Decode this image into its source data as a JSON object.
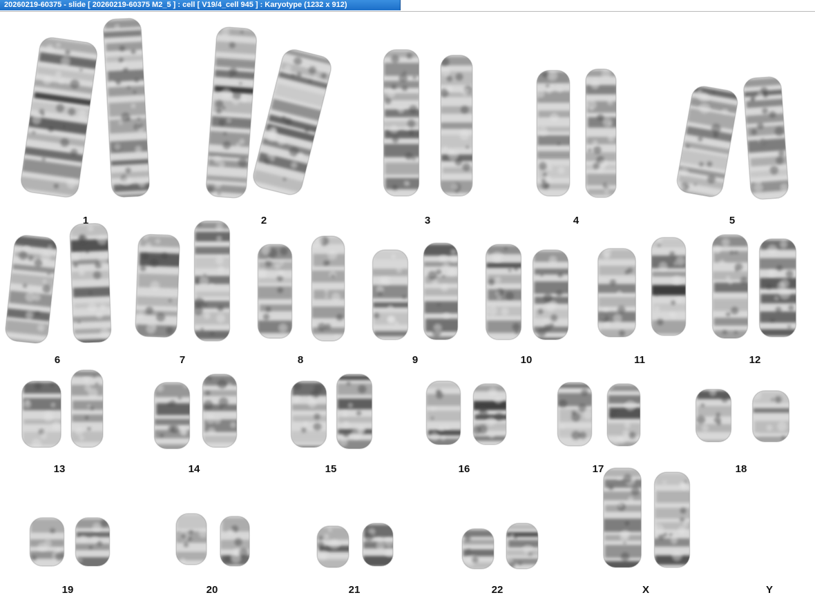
{
  "window": {
    "title": "20260219-60375 - slide [ 20260219-60375 M2_5 ] : cell [ V19/4_cell 945 ] : Karyotype  (1232 x 912)"
  },
  "colors": {
    "title_bar": "#1c6fc9",
    "title_text": "#ffffff",
    "background": "#ffffff",
    "chromosome_light": "#d8d8d8",
    "chromosome_dark": "#2a2a2a"
  },
  "karyotype": {
    "groups": [
      {
        "label": "1",
        "chromosomes": 2
      },
      {
        "label": "2",
        "chromosomes": 2
      },
      {
        "label": "3",
        "chromosomes": 2
      },
      {
        "label": "4",
        "chromosomes": 2
      },
      {
        "label": "5",
        "chromosomes": 2
      },
      {
        "label": "6",
        "chromosomes": 2
      },
      {
        "label": "7",
        "chromosomes": 2
      },
      {
        "label": "8",
        "chromosomes": 2
      },
      {
        "label": "9",
        "chromosomes": 2
      },
      {
        "label": "10",
        "chromosomes": 2
      },
      {
        "label": "11",
        "chromosomes": 2
      },
      {
        "label": "12",
        "chromosomes": 2
      },
      {
        "label": "13",
        "chromosomes": 2
      },
      {
        "label": "14",
        "chromosomes": 2
      },
      {
        "label": "15",
        "chromosomes": 2
      },
      {
        "label": "16",
        "chromosomes": 2
      },
      {
        "label": "17",
        "chromosomes": 2
      },
      {
        "label": "18",
        "chromosomes": 2
      },
      {
        "label": "19",
        "chromosomes": 2
      },
      {
        "label": "20",
        "chromosomes": 2
      },
      {
        "label": "21",
        "chromosomes": 2
      },
      {
        "label": "22",
        "chromosomes": 2
      },
      {
        "label": "X",
        "chromosomes": 2
      },
      {
        "label": "Y",
        "chromosomes": 0
      }
    ]
  }
}
